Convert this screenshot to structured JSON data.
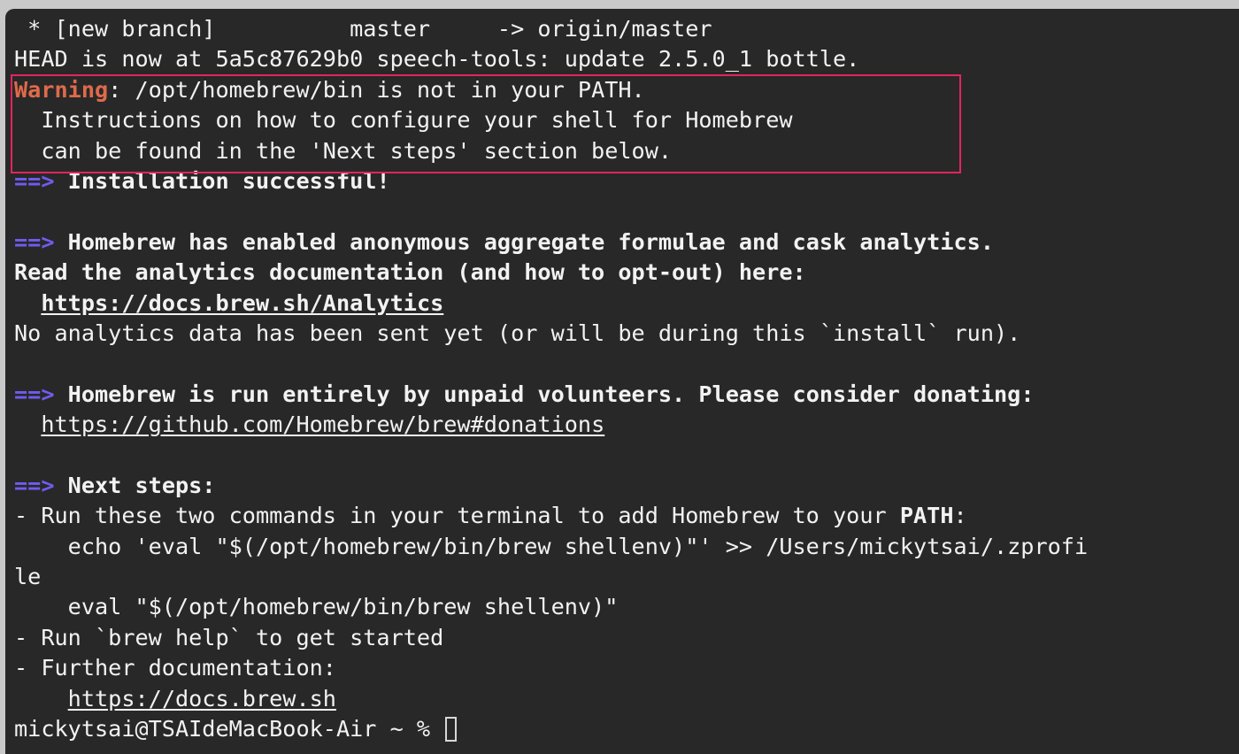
{
  "terminal": {
    "line1": {
      "text": " * [new branch]          master     -> origin/master"
    },
    "line2": {
      "text": "HEAD is now at 5a5c87629b0 speech-tools: update 2.5.0_1 bottle."
    },
    "warning": {
      "label": "Warning",
      "rest": ": /opt/homebrew/bin is not in your PATH.",
      "line2": "  Instructions on how to configure your shell for Homebrew",
      "line3": "  can be found in the 'Next steps' section below."
    },
    "arrow": "==>",
    "installation": " Installation successful!",
    "analytics": {
      "heading": " Homebrew has enabled anonymous aggregate formulae and cask analytics.",
      "read": "Read the analytics documentation (and how to opt-out) here:",
      "indent": "  ",
      "link": "https://docs.brew.sh/Analytics",
      "none": "No analytics data has been sent yet (or will be during this `install` run)."
    },
    "donate": {
      "heading": " Homebrew is run entirely by unpaid volunteers. Please consider donating:",
      "indent": "  ",
      "link": "https://github.com/Homebrew/brew#donations"
    },
    "next_steps": {
      "heading": " Next steps:",
      "run_pre": "- Run these two commands in your terminal to add Homebrew to your ",
      "run_path": "PATH",
      "run_post": ":",
      "echo_cmd": "    echo 'eval \"$(/opt/homebrew/bin/brew shellenv)\"' >> /Users/mickytsai/.zprofi",
      "echo_wrap": "le",
      "eval_cmd": "    eval \"$(/opt/homebrew/bin/brew shellenv)\"",
      "help": "- Run `brew help` to get started",
      "docs": "- Further documentation:",
      "docs_indent": "    ",
      "docs_link": "https://docs.brew.sh"
    },
    "prompt": "mickytsai@TSAIdeMacBook-Air ~ % "
  }
}
